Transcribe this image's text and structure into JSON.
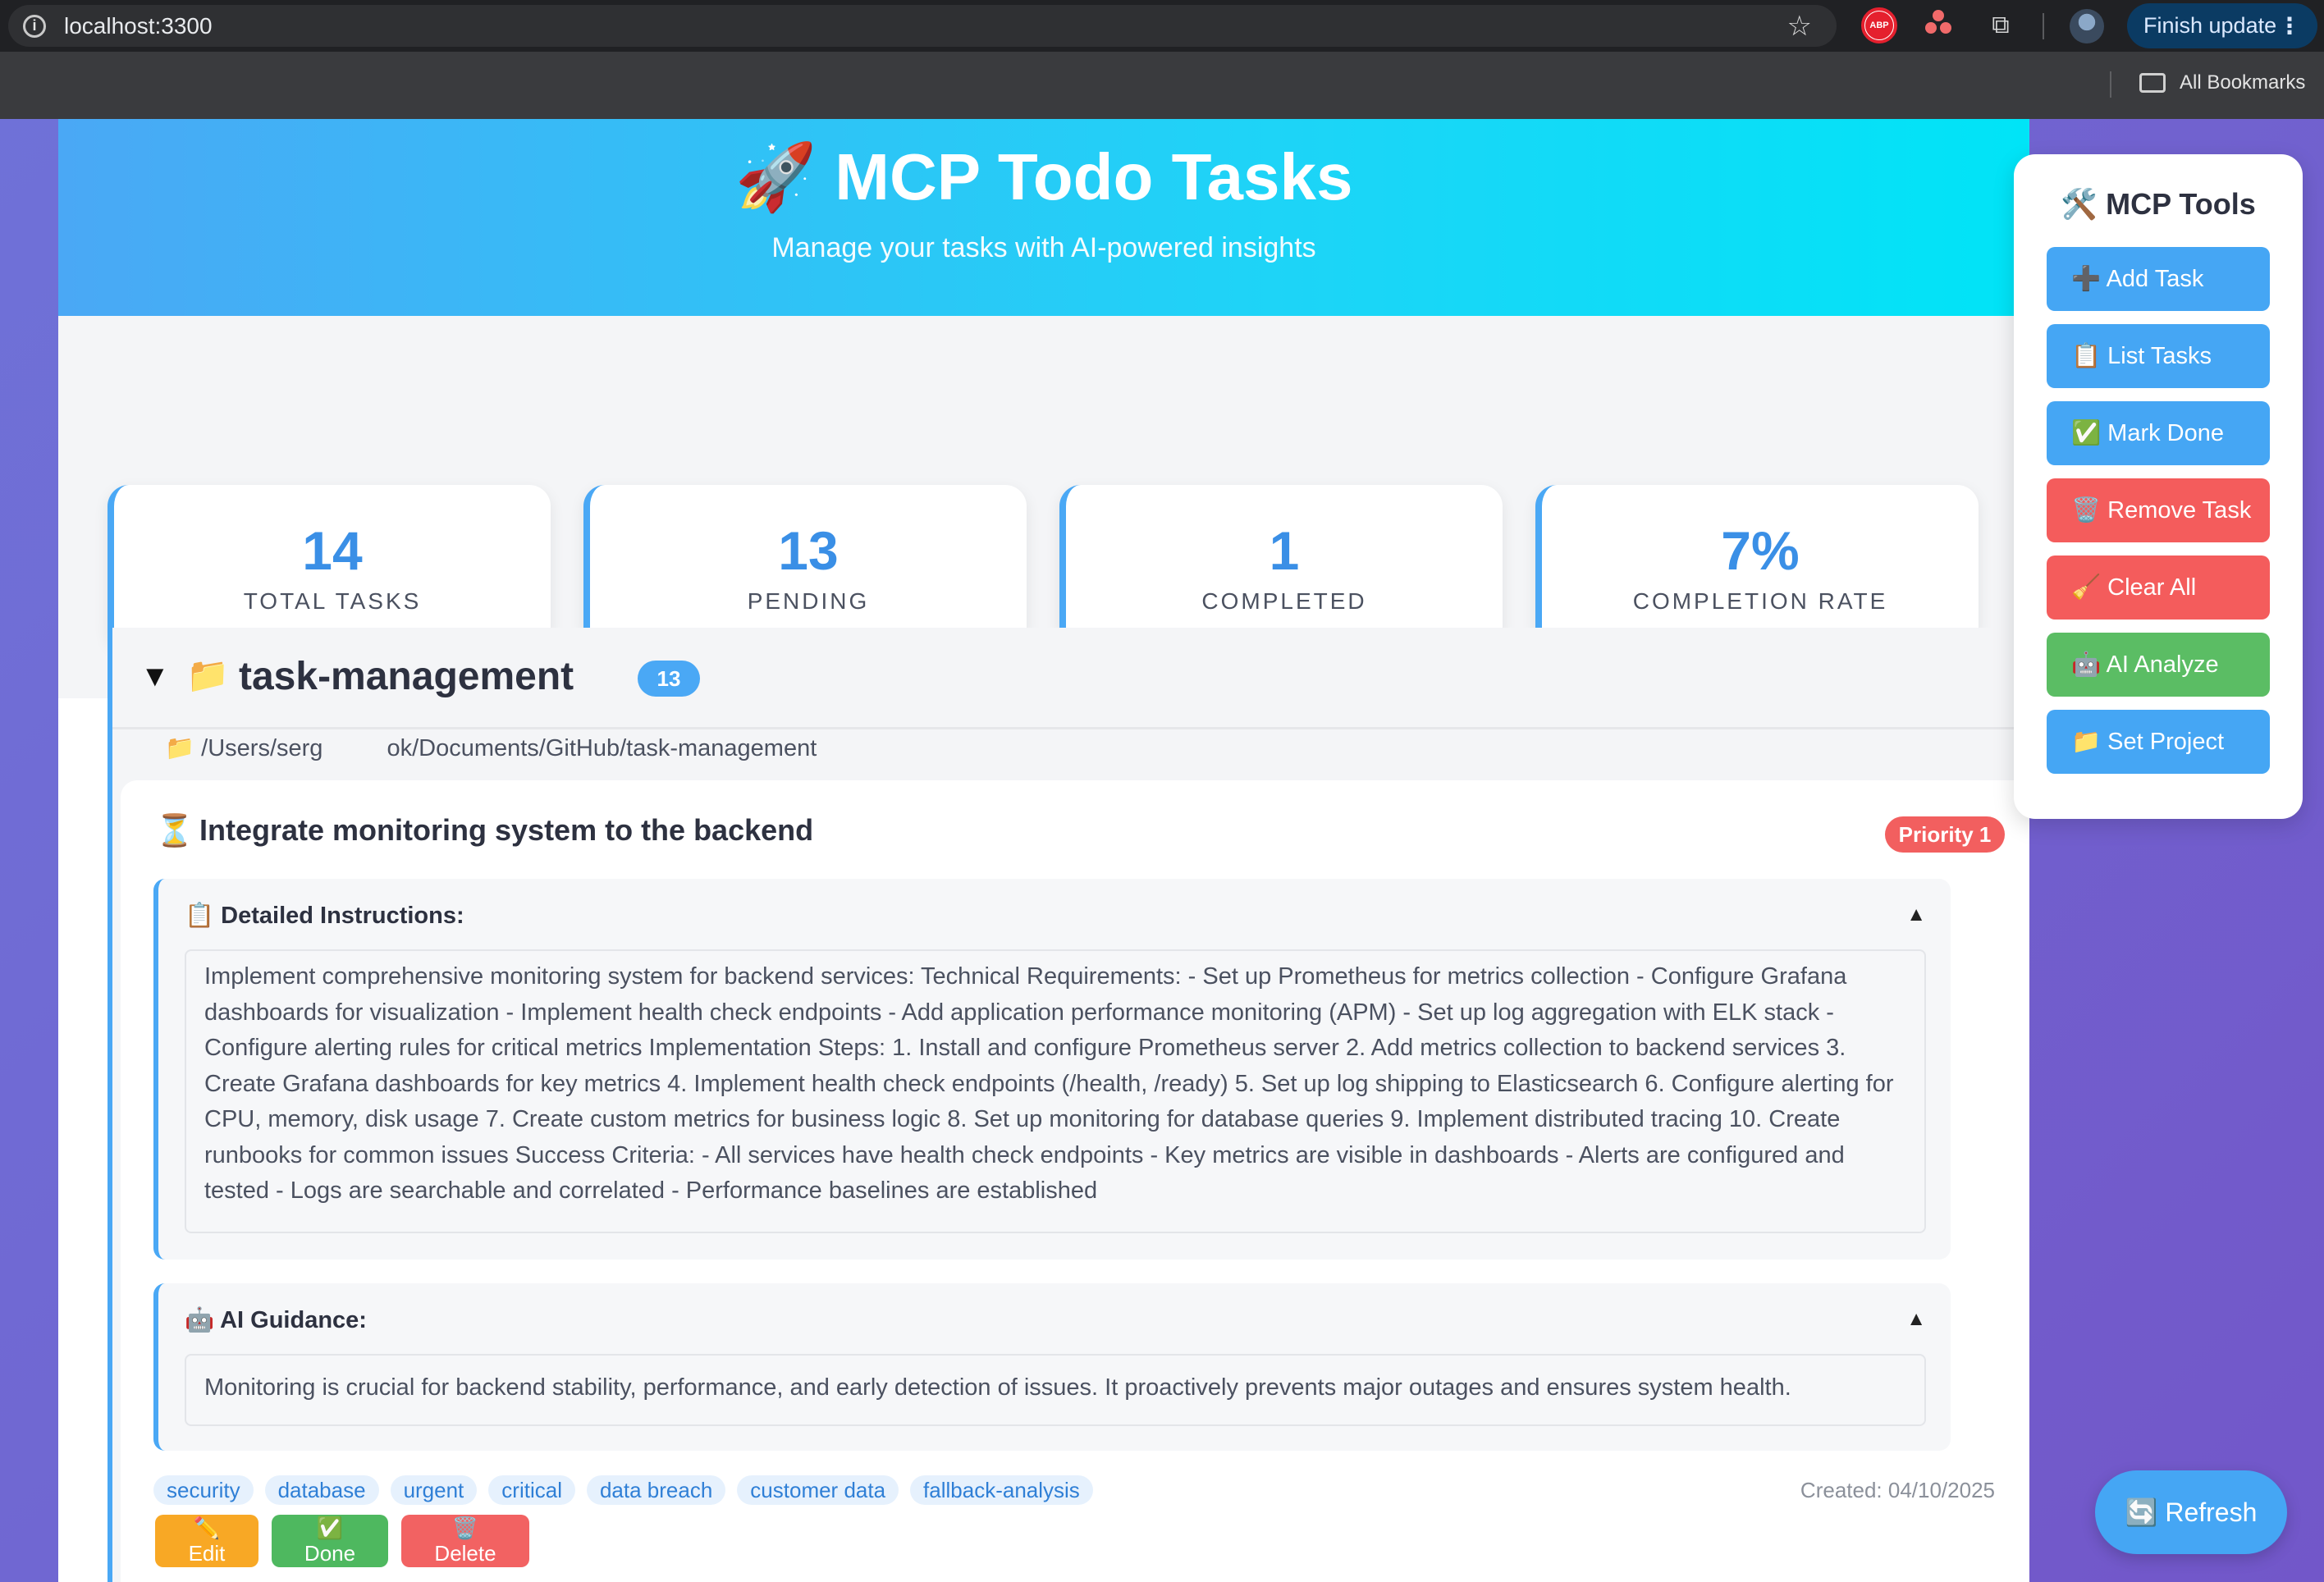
{
  "browser": {
    "url": "localhost:3300",
    "finish_update": "Finish update",
    "bookmarks_label": "All Bookmarks",
    "abp_label": "ABP"
  },
  "header": {
    "title": "🚀 MCP Todo Tasks",
    "subtitle": "Manage your tasks with AI-powered insights"
  },
  "stats": [
    {
      "value": "14",
      "label": "TOTAL TASKS"
    },
    {
      "value": "13",
      "label": "PENDING"
    },
    {
      "value": "1",
      "label": "COMPLETED"
    },
    {
      "value": "7%",
      "label": "COMPLETION RATE"
    }
  ],
  "project": {
    "toggle": "▼",
    "icon": "📁",
    "name": "task-management",
    "count": "13",
    "path_start": "📁 /Users/serg",
    "path_end": "ok/Documents/GitHub/task-management"
  },
  "task": {
    "status_icon": "⏳",
    "title": "Integrate monitoring system to the backend",
    "priority": "Priority 1",
    "instructions_label": "📋 Detailed Instructions:",
    "instructions": "Implement comprehensive monitoring system for backend services: Technical Requirements: - Set up Prometheus for metrics collection - Configure Grafana dashboards for visualization - Implement health check endpoints - Add application performance monitoring (APM) - Set up log aggregation with ELK stack - Configure alerting rules for critical metrics Implementation Steps: 1. Install and configure Prometheus server 2. Add metrics collection to backend services 3. Create Grafana dashboards for key metrics 4. Implement health check endpoints (/health, /ready) 5. Set up log shipping to Elasticsearch 6. Configure alerting for CPU, memory, disk usage 7. Create custom metrics for business logic 8. Set up monitoring for database queries 9. Implement distributed tracing 10. Create runbooks for common issues Success Criteria: - All services have health check endpoints - Key metrics are visible in dashboards - Alerts are configured and tested - Logs are searchable and correlated - Performance baselines are established",
    "guidance_label": "🤖 AI Guidance:",
    "guidance": "Monitoring is crucial for backend stability, performance, and early detection of issues. It proactively prevents major outages and ensures system health.",
    "collapse_glyph": "▲",
    "tags": [
      "security",
      "database",
      "urgent",
      "critical",
      "data breach",
      "customer data",
      "fallback-analysis"
    ],
    "created": "Created: 04/10/2025",
    "actions": {
      "edit": "✏️ Edit",
      "done": "✅ Done",
      "delete": "🗑️ Delete"
    }
  },
  "tools": {
    "title": "🛠️ MCP Tools",
    "buttons": [
      {
        "label": "➕ Add Task",
        "color": "#45a6f4"
      },
      {
        "label": "📋 List Tasks",
        "color": "#45a6f4"
      },
      {
        "label": "✅ Mark Done",
        "color": "#45a6f4"
      },
      {
        "label": "🗑️ Remove Task",
        "color": "#f45c5c"
      },
      {
        "label": "🧹 Clear All",
        "color": "#f45c5c"
      },
      {
        "label": "🤖 AI Analyze",
        "color": "#5bbd64"
      },
      {
        "label": "📁 Set Project",
        "color": "#45a6f4"
      }
    ]
  },
  "refresh_label": "🔄 Refresh"
}
